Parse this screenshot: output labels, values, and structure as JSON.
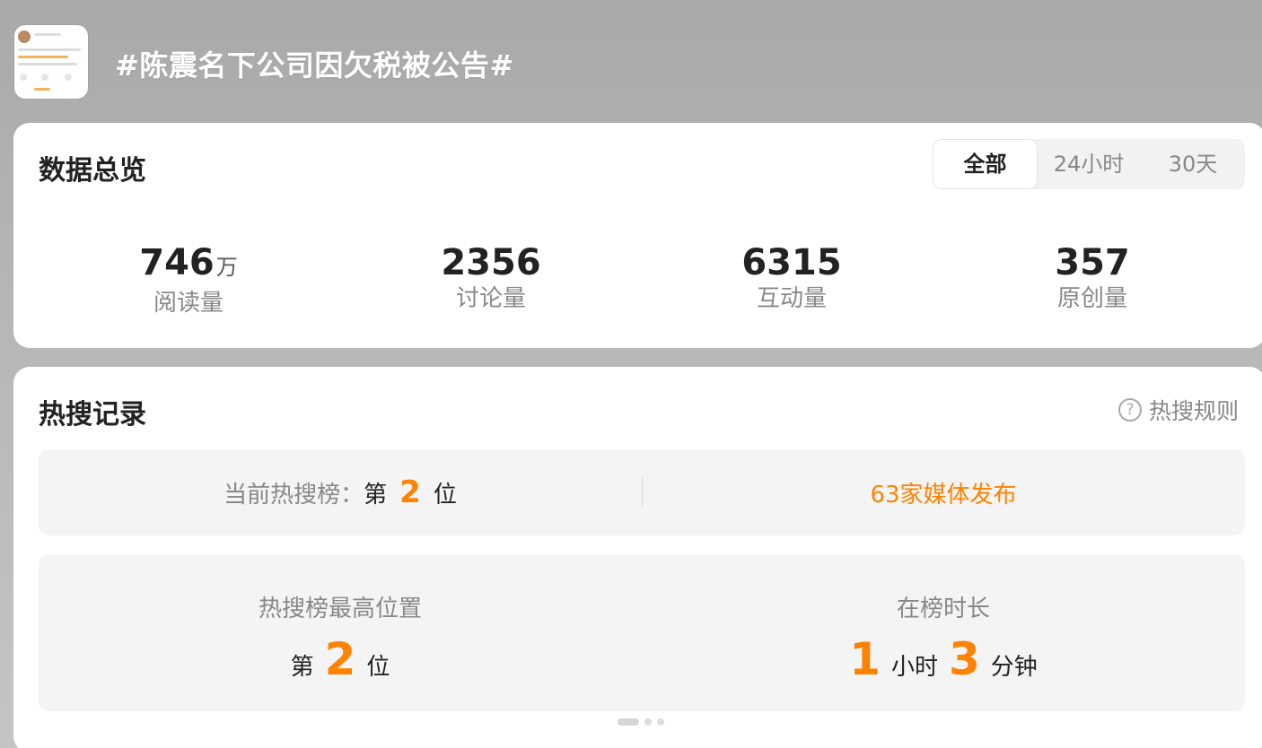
{
  "header": {
    "title": "#陈震名下公司因欠税被公告#"
  },
  "overview": {
    "title": "数据总览",
    "tabs": [
      {
        "label": "全部",
        "active": true
      },
      {
        "label": "24小时",
        "active": false
      },
      {
        "label": "30天",
        "active": false
      }
    ],
    "stats": [
      {
        "value": "746",
        "unit": "万",
        "label": "阅读量"
      },
      {
        "value": "2356",
        "unit": "",
        "label": "讨论量"
      },
      {
        "value": "6315",
        "unit": "",
        "label": "互动量"
      },
      {
        "value": "357",
        "unit": "",
        "label": "原创量"
      }
    ]
  },
  "hot": {
    "title": "热搜记录",
    "rules_label": "热搜规则",
    "current": {
      "prefix": "当前热搜榜：",
      "rank_pre": "第",
      "rank": "2",
      "rank_post": "位"
    },
    "media_text": "63家媒体发布",
    "highest": {
      "label": "热搜榜最高位置",
      "rank_pre": "第",
      "rank": "2",
      "rank_post": "位"
    },
    "duration": {
      "label": "在榜时长",
      "hours": "1",
      "hours_unit": "小时",
      "minutes": "3",
      "minutes_unit": "分钟"
    }
  },
  "colors": {
    "accent": "#ff8200",
    "text_primary": "#222222",
    "text_secondary": "#888888",
    "panel_bg": "#f4f4f4"
  },
  "icons": [
    "question-icon"
  ]
}
